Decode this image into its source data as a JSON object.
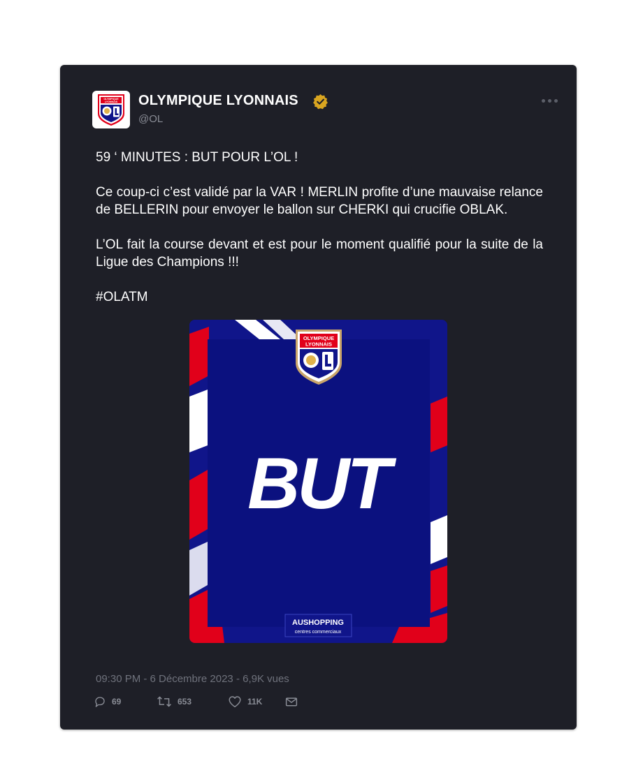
{
  "account": {
    "name": "OLYMPIQUE LYONNAIS",
    "handle": "@OL",
    "logo_text_top": "OLYMPIQUE",
    "logo_text_bottom": "LYONNAIS"
  },
  "tweet": {
    "line1": "59 ‘ MINUTES : BUT POUR L’OL !",
    "para1": "Ce coup-ci c’est validé par la VAR ! MERLIN profite d’une mauvaise relance de BELLERIN pour envoyer le ballon sur CHERKI qui crucifie OBLAK.",
    "para2": "L’OL  fait la course devant et est pour le moment qualifié pour la suite de la Ligue des Champions !!!",
    "hashtag": "#OLATM"
  },
  "media": {
    "headline": "BUT",
    "sponsor": "AUSHOPPING",
    "sponsor_sub": "centres commerciaux"
  },
  "meta": {
    "timeline": "09:30 PM  -  6 Décembre 2023 - 6,9K vues"
  },
  "actions": {
    "replies": "69",
    "retweets": "653",
    "likes": "11K"
  },
  "colors": {
    "card_bg": "#1e1f27",
    "ol_blue": "#10158a",
    "ol_red": "#e1001a",
    "verified_gold": "#d9a520"
  },
  "icons": [
    "verified-badge-icon",
    "more-icon",
    "reply-icon",
    "retweet-icon",
    "like-icon",
    "share-icon"
  ]
}
